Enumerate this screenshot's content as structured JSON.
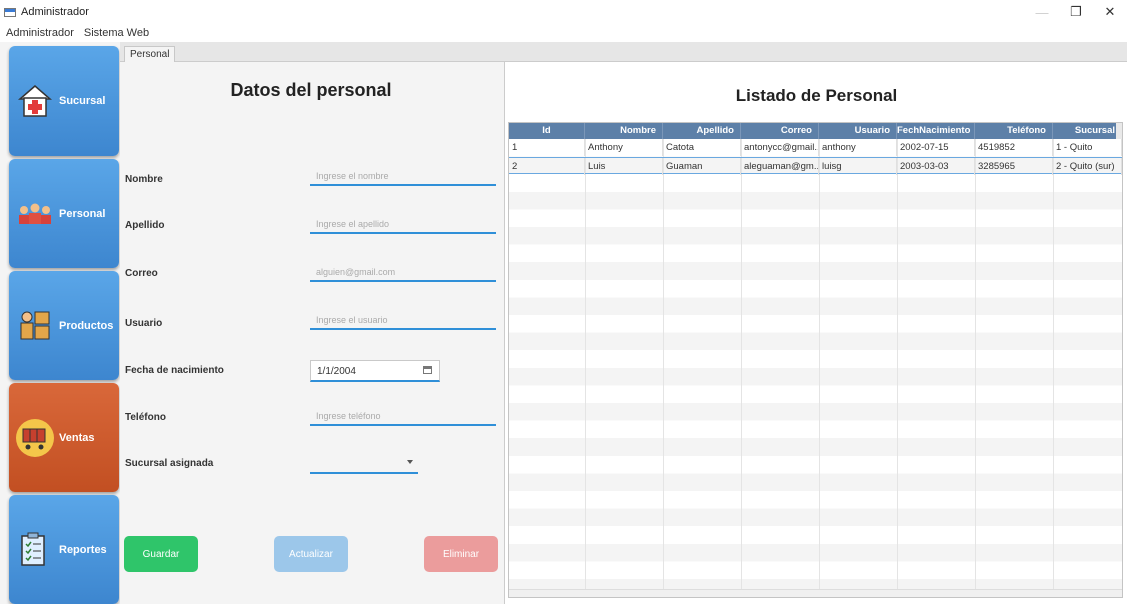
{
  "window": {
    "title": "Administrador",
    "controls": [
      "—",
      "❐",
      "✕"
    ]
  },
  "menu": [
    "Administrador",
    "Sistema Web"
  ],
  "sidebar": [
    {
      "label": "Sucursal",
      "icon": "hospital-icon",
      "color": "#4a96dc"
    },
    {
      "label": "Personal",
      "icon": "people-group-icon",
      "color": "#4a96dc"
    },
    {
      "label": "Productos",
      "icon": "boxes-worker-icon",
      "color": "#4a96dc"
    },
    {
      "label": "Ventas",
      "icon": "shopping-cart-icon",
      "color": "#d05a2c"
    },
    {
      "label": "Reportes",
      "icon": "clipboard-checklist-icon",
      "color": "#4a96dc"
    }
  ],
  "tab": "Personal",
  "form": {
    "title": "Datos del  personal",
    "fields": [
      {
        "label": "Nombre",
        "placeholder": "Ingrese el nombre"
      },
      {
        "label": "Apellido",
        "placeholder": "Ingrese el apellido"
      },
      {
        "label": "Correo",
        "placeholder": "alguien@gmail.com"
      },
      {
        "label": "Usuario",
        "placeholder": "Ingrese el usuario"
      },
      {
        "label": "Fecha de nacimiento",
        "value": "1/1/2004"
      },
      {
        "label": "Teléfono",
        "placeholder": "Ingrese teléfono"
      },
      {
        "label": "Sucursal asignada",
        "value": ""
      }
    ],
    "buttons": {
      "save": "Guardar",
      "update": "Actualizar",
      "delete": "Eliminar"
    }
  },
  "list": {
    "title": "Listado de Personal",
    "columns": [
      "Id",
      "Nombre",
      "Apellido",
      "Correo",
      "Usuario",
      "FechNacimiento",
      "Teléfono",
      "Sucursal"
    ],
    "rows": [
      [
        "1",
        "Anthony",
        "Catota",
        "antonycc@gmail...",
        "anthony",
        "2002-07-15",
        "4519852",
        "1 - Quito"
      ],
      [
        "2",
        "Luis",
        "Guaman",
        "aleguaman@gm...",
        "luisg",
        "2003-03-03",
        "3285965",
        "2 - Quito (sur)"
      ]
    ]
  }
}
